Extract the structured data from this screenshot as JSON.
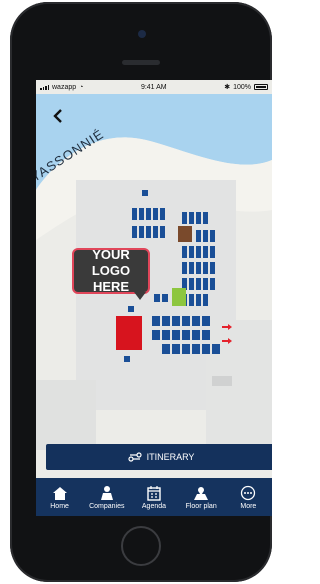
{
  "status": {
    "carrier": "wazapp",
    "time": "9:41 AM",
    "battery": "100%"
  },
  "map": {
    "street_name": "YASSONNIÉ",
    "logo_placeholder_line1": "YOUR LOGO",
    "logo_placeholder_line2": "HERE",
    "colors": {
      "water": "#a9d3ef",
      "booth": "#1a4f97",
      "highlight_red": "#d7141e",
      "highlight_green": "#8dc63f",
      "highlight_brown": "#7a4a2c",
      "arrow": "#e4222c"
    }
  },
  "itinerary": {
    "label": "ITINERARY",
    "icon": "route-icon"
  },
  "tabs": [
    {
      "label": "Home",
      "icon": "home-icon"
    },
    {
      "label": "Companies",
      "icon": "companies-icon"
    },
    {
      "label": "Agenda",
      "icon": "agenda-icon"
    },
    {
      "label": "Floor plan",
      "icon": "floor-plan-icon"
    },
    {
      "label": "More",
      "icon": "more-icon"
    }
  ],
  "colors": {
    "nav": "#15335e",
    "button": "#14315c"
  }
}
